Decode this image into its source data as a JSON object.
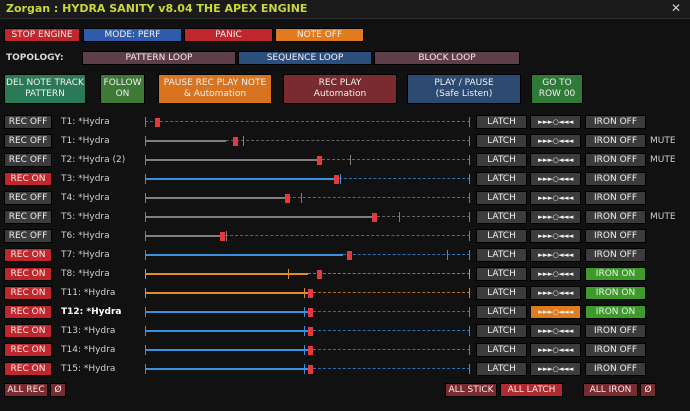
{
  "window": {
    "title": "Zorgan : HYDRA SANITY v8.04 THE APEX ENGINE",
    "close": "✕"
  },
  "top_buttons": {
    "stop": "STOP ENGINE",
    "mode": "MODE: PERF",
    "panic": "PANIC",
    "note_off": "NOTE OFF"
  },
  "topology": {
    "label": "TOPOLOGY:",
    "pattern": "PATTERN LOOP",
    "sequence": "SEQUENCE LOOP",
    "block": "BLOCK LOOP"
  },
  "actions": {
    "del": [
      "DEL NOTE TRACK",
      "PATTERN"
    ],
    "follow": [
      "FOLLOW",
      "ON"
    ],
    "pause_rec": [
      "PAUSE REC PLAY NOTE",
      "& Automation"
    ],
    "rec_play": [
      "REC PLAY",
      "Automation"
    ],
    "play_pause": [
      "PLAY / PAUSE",
      "(Safe Listen)"
    ],
    "goto": [
      "GO TO",
      "ROW 00"
    ]
  },
  "tracks": [
    {
      "rec": "REC OFF",
      "name": "T1: *Hydra",
      "latch": "LATCH",
      "fold": "►►►○◄◄◄",
      "iron": "IRON OFF",
      "mute": "",
      "color": "gray",
      "fill": 0.0,
      "cursor": 0.03,
      "marker": null
    },
    {
      "rec": "REC OFF",
      "name": "T1: *Hydra",
      "latch": "LATCH",
      "fold": "►►►○◄◄◄",
      "iron": "IRON OFF",
      "mute": "MUTE",
      "color": "gray",
      "fill": 0.25,
      "cursor": 0.27,
      "marker": 0.3
    },
    {
      "rec": "REC OFF",
      "name": "T2: *Hydra (2)",
      "latch": "LATCH",
      "fold": "►►►○◄◄◄",
      "iron": "IRON OFF",
      "mute": "MUTE",
      "color": "gray",
      "fill": 0.53,
      "cursor": 0.53,
      "marker": 0.63
    },
    {
      "rec": "REC ON",
      "name": "T3: *Hydra",
      "latch": "LATCH",
      "fold": "►►►○◄◄◄",
      "iron": "IRON OFF",
      "mute": "",
      "color": "blue",
      "fill": 0.58,
      "cursor": 0.58,
      "marker": 0.6
    },
    {
      "rec": "REC OFF",
      "name": "T4: *Hydra",
      "latch": "LATCH",
      "fold": "►►►○◄◄◄",
      "iron": "IRON OFF",
      "mute": "",
      "color": "gray",
      "fill": 0.44,
      "cursor": 0.43,
      "marker": 0.48
    },
    {
      "rec": "REC OFF",
      "name": "T5: *Hydra",
      "latch": "LATCH",
      "fold": "►►►○◄◄◄",
      "iron": "IRON OFF",
      "mute": "MUTE",
      "color": "gray",
      "fill": 0.7,
      "cursor": 0.7,
      "marker": 0.78
    },
    {
      "rec": "REC OFF",
      "name": "T6: *Hydra",
      "latch": "LATCH",
      "fold": "►►►○◄◄◄",
      "iron": "IRON OFF",
      "mute": "",
      "color": "gray",
      "fill": 0.23,
      "cursor": 0.23,
      "marker": 0.25
    },
    {
      "rec": "REC ON",
      "name": "T7: *Hydra",
      "latch": "LATCH",
      "fold": "►►►○◄◄◄",
      "iron": "IRON OFF",
      "mute": "",
      "color": "blue",
      "fill": 0.61,
      "cursor": 0.62,
      "marker": 0.93
    },
    {
      "rec": "REC ON",
      "name": "T8: *Hydra",
      "latch": "LATCH",
      "fold": "►►►○◄◄◄",
      "iron": "IRON ON",
      "mute": "",
      "color": "orange",
      "fill": 0.5,
      "cursor": 0.53,
      "marker": 0.44
    },
    {
      "rec": "REC ON",
      "name": "T11: *Hydra",
      "latch": "LATCH",
      "fold": "►►►○◄◄◄",
      "iron": "IRON ON",
      "mute": "",
      "color": "orange",
      "fill": 0.5,
      "cursor": 0.5,
      "marker": 0.49
    },
    {
      "rec": "REC ON",
      "name": "T12: *Hydra",
      "latch": "LATCH",
      "fold": "►►►○◄◄◄",
      "iron": "IRON ON",
      "mute": "",
      "color": "blue",
      "fill": 0.5,
      "cursor": 0.5,
      "marker": 0.49,
      "fold_active": true,
      "selected": true
    },
    {
      "rec": "REC ON",
      "name": "T13: *Hydra",
      "latch": "LATCH",
      "fold": "►►►○◄◄◄",
      "iron": "IRON OFF",
      "mute": "",
      "color": "blue",
      "fill": 0.5,
      "cursor": 0.5,
      "marker": 0.49
    },
    {
      "rec": "REC ON",
      "name": "T14: *Hydra",
      "latch": "LATCH",
      "fold": "►►►○◄◄◄",
      "iron": "IRON OFF",
      "mute": "",
      "color": "blue",
      "fill": 0.5,
      "cursor": 0.5,
      "marker": 0.49
    },
    {
      "rec": "REC ON",
      "name": "T15: *Hydra",
      "latch": "LATCH",
      "fold": "►►►○◄◄◄",
      "iron": "IRON OFF",
      "mute": "",
      "color": "blue",
      "fill": 0.5,
      "cursor": 0.5,
      "marker": 0.49
    }
  ],
  "footer": {
    "all_rec": "ALL REC",
    "clear_rec": "Ø",
    "all_stick": "ALL STICK",
    "all_latch": "ALL LATCH",
    "all_iron": "ALL IRON",
    "clear_iron": "Ø"
  },
  "colors": {
    "accent": "#c8d83a",
    "rec_on": "#c0272d",
    "iron_on": "#3d9a2b",
    "fold_active": "#e07b1e",
    "blue_line": "#3b8fe0",
    "orange_line": "#e08c2a",
    "cursor": "#e5393d"
  }
}
